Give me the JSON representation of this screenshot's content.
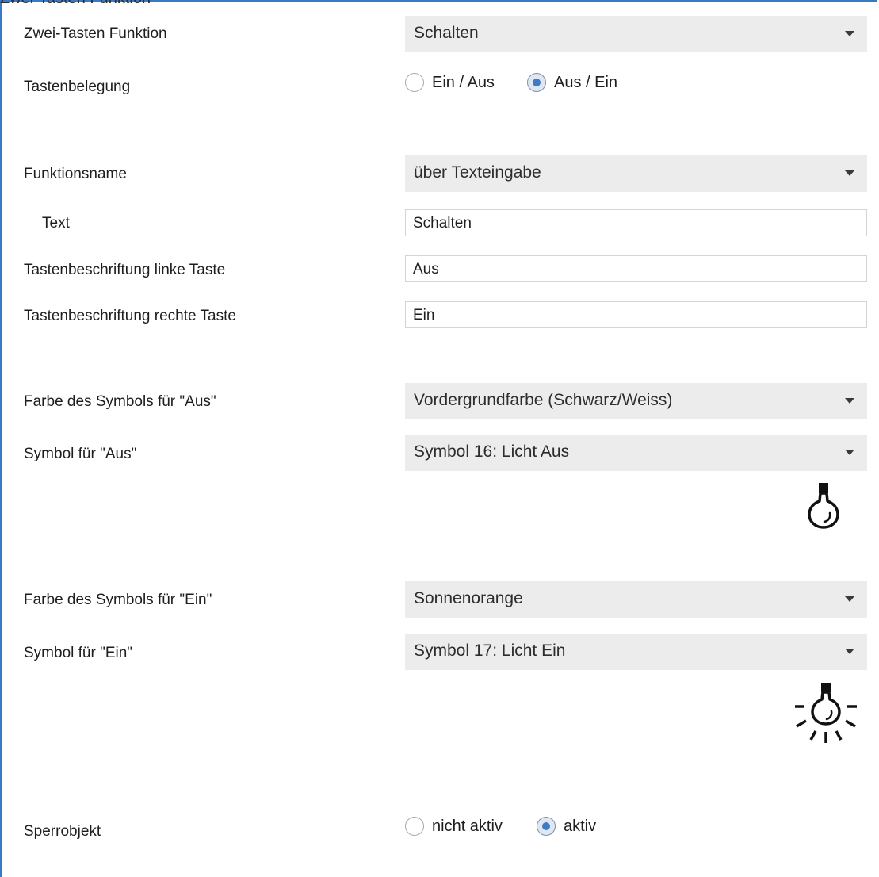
{
  "window_title": "Zwei-Tasten Funktion",
  "rows": {
    "zwei_tasten": {
      "label": "Zwei-Tasten Funktion",
      "value": "Schalten"
    },
    "tastenbelegung": {
      "label": "Tastenbelegung",
      "options": [
        "Ein / Aus",
        "Aus / Ein"
      ],
      "selected": "Aus / Ein"
    },
    "funktionsname": {
      "label": "Funktionsname",
      "value": "über Texteingabe"
    },
    "text": {
      "label": "Text",
      "value": "Schalten"
    },
    "linke_taste": {
      "label": "Tastenbeschriftung linke Taste",
      "value": "Aus"
    },
    "rechte_taste": {
      "label": "Tastenbeschriftung rechte Taste",
      "value": "Ein"
    },
    "farbe_aus": {
      "label": "Farbe des Symbols für \"Aus\"",
      "value": "Vordergrundfarbe (Schwarz/Weiss)"
    },
    "symbol_aus": {
      "label": "Symbol für \"Aus\"",
      "value": "Symbol 16: Licht Aus",
      "icon": "light-off-icon"
    },
    "farbe_ein": {
      "label": "Farbe des Symbols für \"Ein\"",
      "value": "Sonnenorange"
    },
    "symbol_ein": {
      "label": "Symbol für \"Ein\"",
      "value": "Symbol 17: Licht Ein",
      "icon": "light-on-icon"
    },
    "sperrobjekt": {
      "label": "Sperrobjekt",
      "options": [
        "nicht aktiv",
        "aktiv"
      ],
      "selected": "aktiv"
    }
  },
  "colors": {
    "frame": "#3a79c4",
    "select_bg": "#ececec",
    "radio_on": "#3f7ac3"
  }
}
